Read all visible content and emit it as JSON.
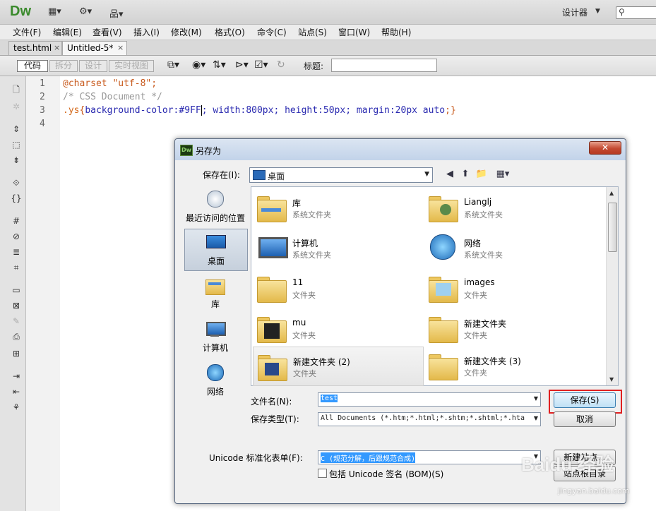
{
  "app": {
    "logo": "Dw",
    "designer_label": "设计器",
    "search_icon": "⚲"
  },
  "menu": [
    "文件(F)",
    "编辑(E)",
    "查看(V)",
    "插入(I)",
    "修改(M)",
    "格式(O)",
    "命令(C)",
    "站点(S)",
    "窗口(W)",
    "帮助(H)"
  ],
  "doc_tabs": [
    {
      "label": "test.html",
      "close": "×"
    },
    {
      "label": "Untitled-5*",
      "close": "×"
    }
  ],
  "toolbar": {
    "views": [
      "代码",
      "拆分",
      "设计",
      "实时视图"
    ],
    "title_label": "标题:",
    "title_value": ""
  },
  "code": {
    "line_numbers": [
      "1",
      "2",
      "3",
      "4"
    ],
    "line1": {
      "at": "@charset ",
      "str": "\"utf-8\";"
    },
    "line2": "/* CSS Document */",
    "line3": {
      "selector": ".ys",
      "brace_open": "{",
      "p1": "background-color:",
      "v1": "#9FF",
      "p2": "; width:",
      "v2": "800px",
      "p3": "; height:",
      "v3": "50px",
      "p4": "; margin:",
      "v4": "20px auto",
      "end": ";}"
    }
  },
  "dialog": {
    "icon_text": "Dw",
    "title": "另存为",
    "close": "✕",
    "save_in_label": "保存在(I):",
    "save_in_value": "桌面",
    "places": [
      {
        "label": "最近访问的位置"
      },
      {
        "label": "桌面"
      },
      {
        "label": "库"
      },
      {
        "label": "计算机"
      },
      {
        "label": "网络"
      }
    ],
    "files": [
      {
        "name": "库",
        "type": "系统文件夹"
      },
      {
        "name": "Lianglj",
        "type": "系统文件夹"
      },
      {
        "name": "计算机",
        "type": "系统文件夹"
      },
      {
        "name": "网络",
        "type": "系统文件夹"
      },
      {
        "name": "11",
        "type": "文件夹"
      },
      {
        "name": "images",
        "type": "文件夹"
      },
      {
        "name": "mu",
        "type": "文件夹"
      },
      {
        "name": "新建文件夹",
        "type": "文件夹"
      },
      {
        "name": "新建文件夹 (2)",
        "type": "文件夹"
      },
      {
        "name": "新建文件夹 (3)",
        "type": "文件夹"
      }
    ],
    "filename_label": "文件名(N):",
    "filename_value": "test",
    "filetype_label": "保存类型(T):",
    "filetype_value": "All Documents (*.htm;*.html;*.shtm;*.shtml;*.hta;",
    "save_button": "保存(S)",
    "cancel_button": "取消",
    "unicode_label": "Unicode 标准化表单(F):",
    "unicode_value": "C (规范分解，后跟规范合成)",
    "new_site_button": "新建站点...",
    "site_root_button": "站点根目录",
    "bom_label": "包括 Unicode 签名 (BOM)(S)"
  },
  "watermark": {
    "main": "Baidu 经验",
    "sub": "jingyan.baidu.com"
  }
}
